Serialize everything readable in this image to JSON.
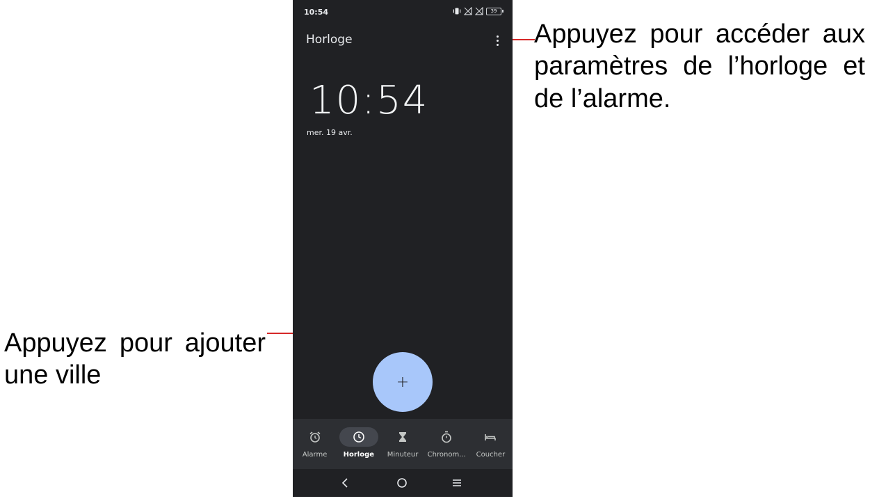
{
  "callouts": {
    "menu": "Appuyez pour accéder aux paramètres de l’horloge et de l’alarme.",
    "add_city_line1": "Appuyez pour ajouter",
    "add_city_line2": "une ville"
  },
  "status_bar": {
    "time": "10:54",
    "battery": "39"
  },
  "app": {
    "title": "Horloge",
    "clock_time": "10:54",
    "date": "mer. 19 avr.",
    "fab_label": "+"
  },
  "bottom_nav": {
    "items": [
      {
        "label": "Alarme",
        "icon": "alarm-icon",
        "active": false
      },
      {
        "label": "Horloge",
        "icon": "clock-icon",
        "active": true
      },
      {
        "label": "Minuteur",
        "icon": "hourglass-icon",
        "active": false
      },
      {
        "label": "Chronom...",
        "icon": "stopwatch-icon",
        "active": false
      },
      {
        "label": "Coucher",
        "icon": "bed-icon",
        "active": false
      }
    ]
  },
  "system_nav": {
    "back_glyph": "<",
    "home_icon": "circle-icon",
    "recents_icon": "menu-lines-icon"
  },
  "colors": {
    "background": "#202124",
    "fab": "#a8c7fa",
    "nav_bar": "#2d2f33",
    "active_pill": "#44474e",
    "leader_line": "#d62828"
  }
}
